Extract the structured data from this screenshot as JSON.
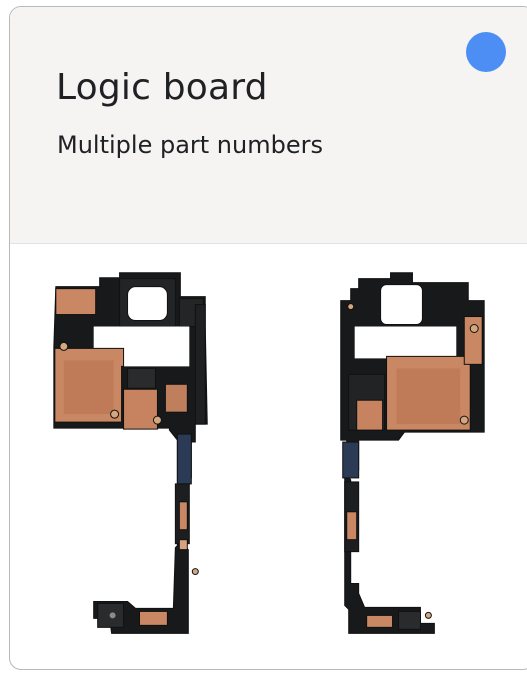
{
  "card": {
    "title": "Logic board",
    "subtitle": "Multiple part numbers"
  },
  "colors": {
    "status_dot": "#4d8ef5",
    "header_bg": "#f5f4f3",
    "copper": "#c98763",
    "pcb_black": "#17191a"
  },
  "icons": {
    "status": "status-dot-icon"
  }
}
